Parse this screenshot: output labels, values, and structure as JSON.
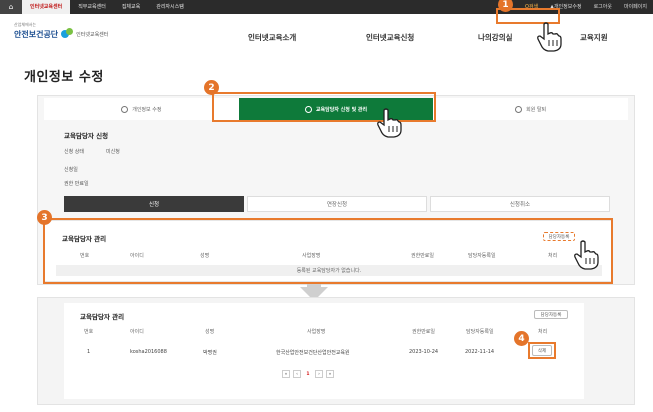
{
  "topbar": {
    "tabs": [
      "인터넷교육센터",
      "직무교육센터",
      "집체교육",
      "관리자시스템"
    ],
    "right": [
      "O검색",
      "▲개인정보수정",
      "로그아웃",
      "마이페이지"
    ]
  },
  "header": {
    "org_small": "산업체에서는",
    "org": "안전보건공단",
    "sub": "인터넷교육센터",
    "gnb": [
      "인터넷교육소개",
      "인터넷교육신청",
      "나의강의실",
      "교육지원"
    ]
  },
  "page_title": "개인정보 수정",
  "tabs": [
    "개인정보 수정",
    "교육담당자 신청 및 관리",
    "회원 탈퇴"
  ],
  "apply": {
    "title": "교육담당자 신청",
    "status_label": "신청 상태",
    "status_value": "미신청",
    "date_label": "신청일",
    "approve_label": "권한 만료일",
    "buttons": [
      "신청",
      "연장신청",
      "신청취소"
    ]
  },
  "manage": {
    "title": "교육담당자 관리",
    "register_button": "담당자등록",
    "columns": [
      "번호",
      "아이디",
      "성명",
      "사업장명",
      "권한만료일",
      "담당자등록일",
      "처리"
    ],
    "empty": "등록된 교육담당자가 없습니다."
  },
  "lower": {
    "title": "교육담당자 관리",
    "register_button": "담당자등록",
    "columns": [
      "번호",
      "아이디",
      "성명",
      "사업장명",
      "권한만료일",
      "담당자등록일",
      "처리"
    ],
    "row": {
      "no": "1",
      "id": "kosha2016088",
      "name": "박명권",
      "company": "한국산업안전보건단산업안전교육원",
      "expire": "2023-10-24",
      "registered": "2022-11-14",
      "action": "삭제"
    },
    "pager": [
      "«",
      "‹",
      "1",
      "›",
      "»"
    ]
  },
  "badges": [
    "1",
    "2",
    "3",
    "4"
  ],
  "colors": {
    "accent": "#e87a2d",
    "active_tab": "#0e7a3a",
    "brand": "#1d4f91"
  }
}
